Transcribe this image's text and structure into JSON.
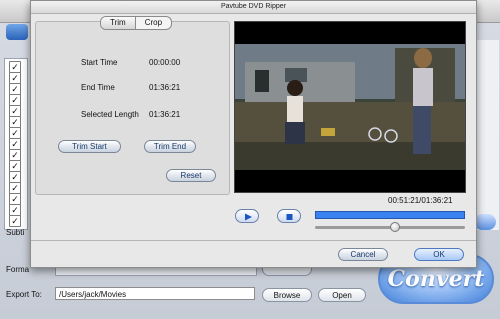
{
  "window": {
    "title": "Pavtube DVD Ripper"
  },
  "trim_panel": {
    "tabs": [
      {
        "label": "Trim",
        "active": true
      },
      {
        "label": "Crop",
        "active": false
      }
    ],
    "start_time": {
      "label": "Start Time",
      "value": "00:00:00"
    },
    "end_time": {
      "label": "End Time",
      "value": "01:36:21"
    },
    "selected_length": {
      "label": "Selected Length",
      "value": "01:36:21"
    },
    "trim_start_label": "Trim Start",
    "trim_end_label": "Trim End",
    "reset_label": "Reset"
  },
  "player": {
    "time_readout": "00:51:21/01:36:21",
    "play_icon": "play-icon",
    "stop_icon": "stop-icon",
    "progress_fraction": 1.0,
    "volume_fraction": 0.53
  },
  "dialog_buttons": {
    "cancel_label": "Cancel",
    "ok_label": "OK"
  },
  "main_window": {
    "subtitle_label": "Subti",
    "format_label": "Forma",
    "export_label": "Export To:",
    "export_path": "/Users/jack/Movies",
    "browse_label": "Browse",
    "open_label": "Open",
    "convert_label": "Convert",
    "checkbox_count": 15
  },
  "colors": {
    "accent": "#2f74e6",
    "convert": "#3f7fd9"
  }
}
